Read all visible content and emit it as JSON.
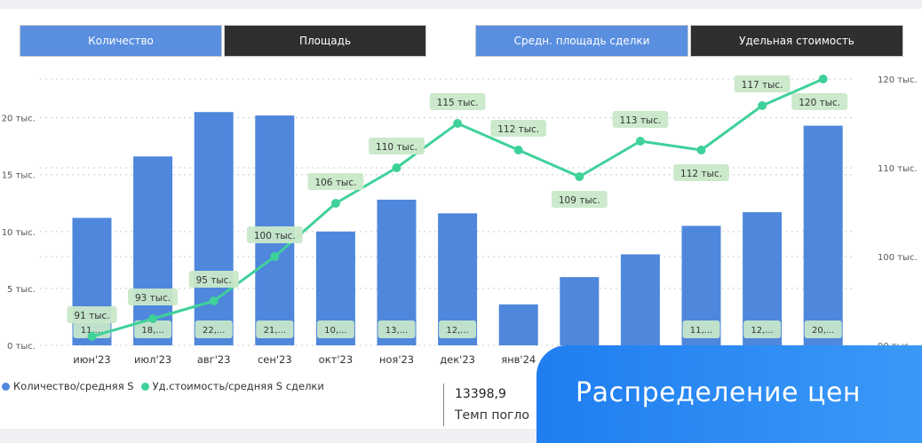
{
  "tabs": [
    {
      "label": "Количество"
    },
    {
      "label": "Площадь"
    },
    {
      "label": "Средн. площадь сделки"
    },
    {
      "label": "Удельная стоимость"
    }
  ],
  "colors": {
    "bar": "#4f87dc",
    "line": "#3fd19a",
    "label_bg": "#c9e8c9",
    "grid": "#cccccc"
  },
  "chart_data": {
    "type": "bar",
    "categories": [
      "июн'23",
      "июл'23",
      "авг'23",
      "сен'23",
      "окт'23",
      "ноя'23",
      "дек'23",
      "янв'24",
      "",
      "",
      "",
      "",
      ""
    ],
    "y_axis_left": {
      "ticks": [
        "0 тыс.",
        "5 тыс.",
        "10 тыс.",
        "15 тыс.",
        "20 тыс."
      ],
      "tick_values": [
        0,
        5000,
        10000,
        15000,
        20000
      ],
      "range": [
        0,
        22000
      ]
    },
    "y_axis_right": {
      "ticks": [
        "90 тыс.",
        "100 тыс.",
        "110 тыс.",
        "120 тыс."
      ],
      "tick_values": [
        90000,
        100000,
        110000,
        120000
      ],
      "range": [
        90000,
        120500
      ]
    },
    "series": [
      {
        "name": "Количество/средняя S",
        "type": "bar",
        "axis": "left",
        "values": [
          11200,
          16600,
          20500,
          20200,
          10000,
          12800,
          11600,
          3600,
          6000,
          8000,
          10500,
          11700,
          19300
        ],
        "labels": [
          "11,...",
          "18,...",
          "22,...",
          "21,...",
          "10,...",
          "13,...",
          "12,...",
          "",
          "",
          "",
          "11,...",
          "12,...",
          "20,..."
        ]
      },
      {
        "name": "Уд.стоимость/средняя S сделки",
        "type": "line",
        "axis": "right",
        "values": [
          91000,
          93000,
          95000,
          100000,
          106000,
          110000,
          115000,
          112000,
          109000,
          113000,
          112000,
          117000,
          120000
        ],
        "labels": [
          "91 тыс.",
          "93 тыс.",
          "95 тыс.",
          "100 тыс.",
          "106 тыс.",
          "110 тыс.",
          "115 тыс.",
          "112 тыс.",
          "109 тыс.",
          "113 тыс.",
          "112 тыс.",
          "117 тыс.",
          "120 тыс."
        ]
      }
    ],
    "grid": true,
    "legend": "bottom-left"
  },
  "kpi": {
    "value": "13398,9",
    "label": "Темп погло"
  },
  "banner": {
    "text": "Распределение цен"
  }
}
